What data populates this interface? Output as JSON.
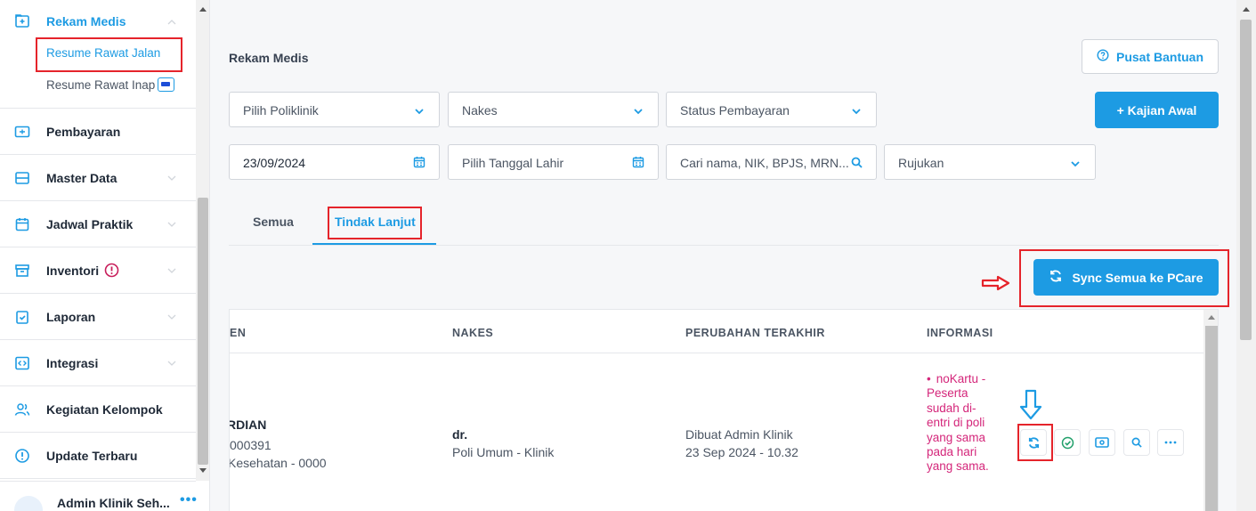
{
  "sidebar": {
    "rekam_medis": {
      "label": "Rekam Medis",
      "sub": [
        "Resume Rawat Jalan",
        "Resume Rawat Inap"
      ]
    },
    "items": [
      {
        "label": "Pembayaran",
        "icon": "cash-icon"
      },
      {
        "label": "Master Data",
        "icon": "database-icon"
      },
      {
        "label": "Jadwal Praktik",
        "icon": "calendar-icon"
      },
      {
        "label": "Inventori",
        "icon": "archive-icon"
      },
      {
        "label": "Laporan",
        "icon": "clipboard-icon"
      },
      {
        "label": "Integrasi",
        "icon": "integration-icon"
      },
      {
        "label": "Kegiatan Kelompok",
        "icon": "users-icon"
      },
      {
        "label": "Update Terbaru",
        "icon": "info-icon"
      }
    ],
    "user": {
      "name": "Admin Klinik Seh...",
      "more": "•••"
    }
  },
  "header": {
    "title": "Rekam Medis",
    "help_label": "Pusat Bantuan",
    "add_label": "+ Kajian Awal"
  },
  "filters": {
    "poliklinik": "Pilih Poliklinik",
    "nakes": "Nakes",
    "status_pembayaran": "Status Pembayaran",
    "tanggal": "23/09/2024",
    "tanggal_lahir": "Pilih Tanggal Lahir",
    "search_placeholder": "Cari nama, NIK, BPJS, MRN...",
    "rujukan": "Rujukan"
  },
  "tabs": [
    {
      "label": "Semua"
    },
    {
      "label": "Tindak Lanjut"
    }
  ],
  "sync_label": "Sync Semua ke PCare",
  "table": {
    "headers": [
      "EN",
      "NAKES",
      "PERUBAHAN TERAKHIR",
      "INFORMASI"
    ],
    "row": {
      "patient_name": "RDIAN",
      "patient_id": "000391",
      "patient_insurance": "Kesehatan - 0000",
      "nakes_name": "dr.",
      "nakes_poli": "Poli Umum - Klinik",
      "changed_by": "Dibuat Admin Klinik",
      "changed_at": "23 Sep 2024 - 10.32",
      "info_bullet": "•",
      "info": "noKartu - Peserta sudah di-entri di poli yang sama pada hari yang sama."
    }
  },
  "colors": {
    "accent": "#1d9be3",
    "highlight": "#e5242b",
    "info_text": "#d4267a",
    "alert": "#c81e5b"
  }
}
